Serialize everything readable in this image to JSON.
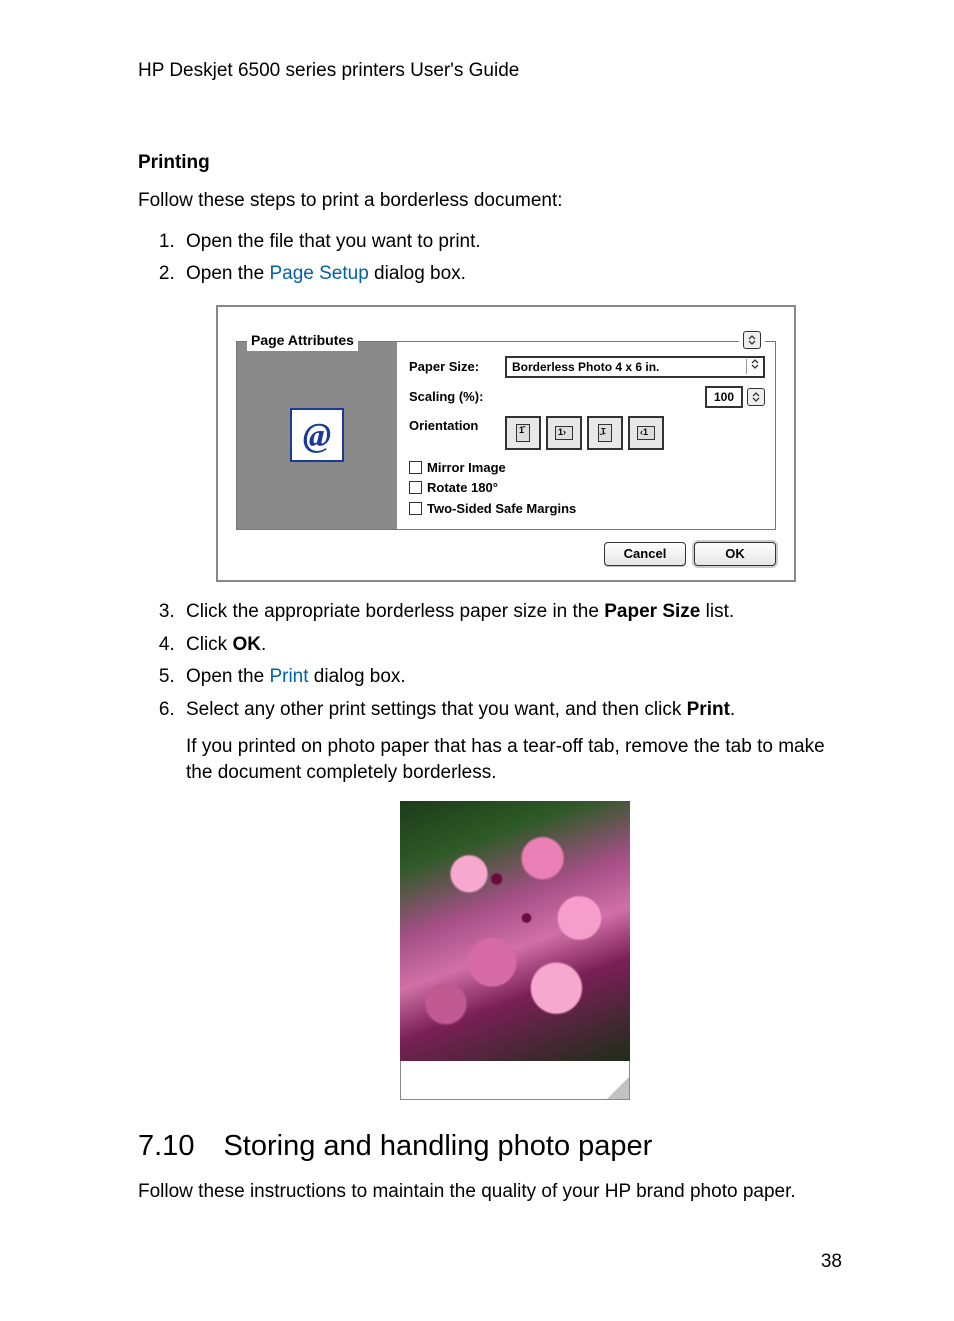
{
  "header_title": "HP Deskjet 6500 series printers User's Guide",
  "section1_title": "Printing",
  "intro_text": "Follow these steps to print a borderless document:",
  "steps_a": {
    "s1": "Open the file that you want to print.",
    "s2_pre": "Open the ",
    "s2_link": "Page Setup",
    "s2_post": " dialog box."
  },
  "dialog": {
    "tab_label": "Page Attributes",
    "paper_size_label": "Paper Size:",
    "paper_size_value": "Borderless Photo 4 x 6 in.",
    "scaling_label": "Scaling (%):",
    "scaling_value": "100",
    "orientation_label": "Orientation",
    "check_mirror": "Mirror Image",
    "check_rotate": "Rotate 180°",
    "check_twosided": "Two-Sided Safe Margins",
    "cancel": "Cancel",
    "ok": "OK"
  },
  "steps_b": {
    "s3_pre": "Click the appropriate borderless paper size in the ",
    "s3_bold": "Paper Size",
    "s3_post": " list.",
    "s4_pre": "Click ",
    "s4_bold": "OK",
    "s4_post": ".",
    "s5_pre": "Open the ",
    "s5_link": "Print",
    "s5_post": " dialog box.",
    "s6_pre": "Select any other print settings that you want, and then click ",
    "s6_bold": "Print",
    "s6_post": ".",
    "s6_extra": "If you printed on photo paper that has a tear-off tab, remove the tab to make the document completely borderless."
  },
  "chapter_title": "7.10 Storing and handling photo paper",
  "chapter_intro": "Follow these instructions to maintain the quality of your HP brand photo paper.",
  "page_number": "38"
}
